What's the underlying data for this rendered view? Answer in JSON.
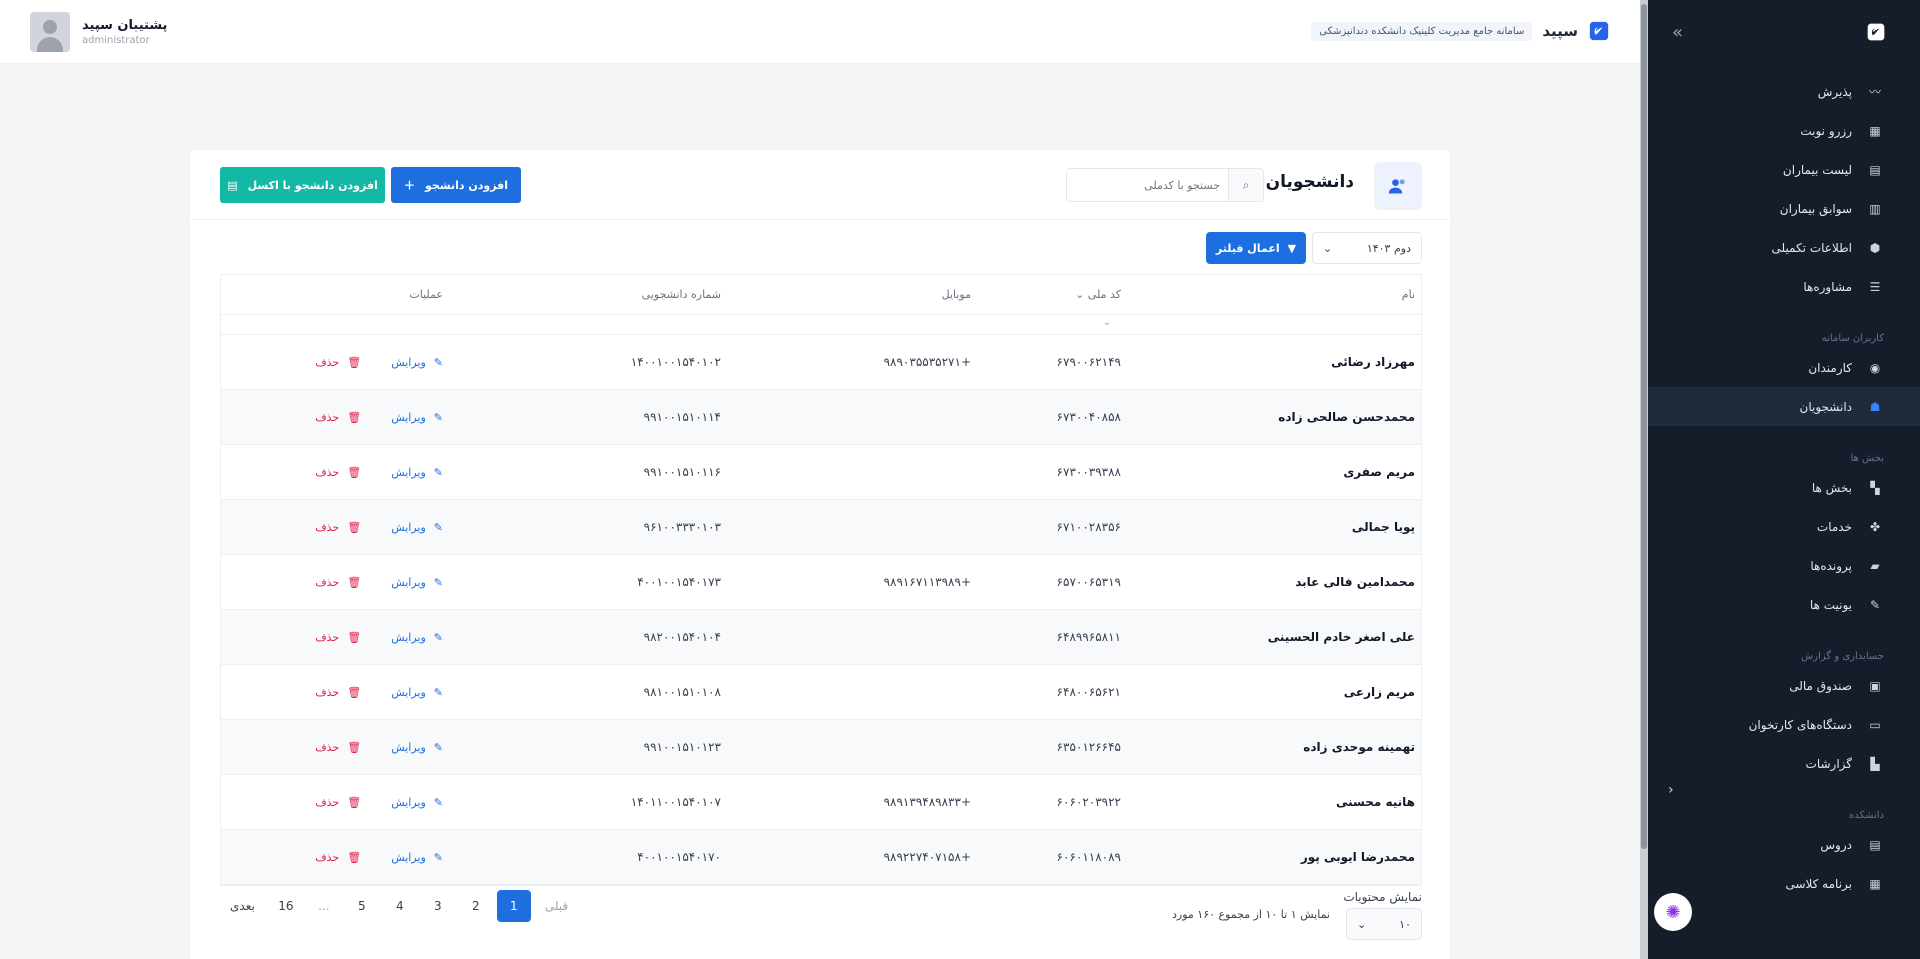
{
  "brand": {
    "name": "سپید",
    "subtitle": "سامانه جامع مدیریت کلینیک دانشکده دندانپزشکی"
  },
  "user": {
    "name": "پشتیبان سپید",
    "role": "administrator"
  },
  "sidebar": {
    "main_items": [
      {
        "label": "پذیرش",
        "icon": "heartbeat-icon"
      },
      {
        "label": "رزرو نوبت",
        "icon": "calendar-icon"
      },
      {
        "label": "لیست بیماران",
        "icon": "contacts-icon"
      },
      {
        "label": "سوابق بیماران",
        "icon": "document-icon"
      },
      {
        "label": "اطلاعات تکمیلی",
        "icon": "cube-icon"
      },
      {
        "label": "مشاوره‌ها",
        "icon": "bars-icon"
      }
    ],
    "section_users": "کاربران سامانه",
    "users_items": [
      {
        "label": "کارمندان",
        "icon": "user-circle-icon"
      },
      {
        "label": "دانشجویان",
        "icon": "students-icon"
      }
    ],
    "section_depts": "بخش ها",
    "dept_items": [
      {
        "label": "بخش ها",
        "icon": "grid-icon"
      },
      {
        "label": "خدمات",
        "icon": "fan-icon"
      },
      {
        "label": "پرونده‌ها",
        "icon": "folder-icon"
      },
      {
        "label": "یونیت ها",
        "icon": "syringe-icon"
      }
    ],
    "section_finance": "حسابداری و گزارش",
    "finance_items": [
      {
        "label": "صندوق مالی",
        "icon": "cash-box-icon"
      },
      {
        "label": "دستگاه‌های کارتخوان",
        "icon": "card-reader-icon"
      },
      {
        "label": "گزارشات",
        "icon": "chart-icon"
      }
    ],
    "section_faculty": "دانشکده",
    "faculty_items": [
      {
        "label": "دروس",
        "icon": "book-icon"
      },
      {
        "label": "برنامه کلاسی",
        "icon": "schedule-icon"
      }
    ]
  },
  "page": {
    "title": "دانشجویان",
    "search_placeholder": "جستجو با کدملی",
    "add_button": "افزودن دانشجو",
    "excel_button": "افزودن دانشجو با اکسل",
    "semester": "دوم ۱۴۰۳",
    "filter_button": "اعمال فیلتر"
  },
  "table": {
    "headers": {
      "name": "نام",
      "nid": "کد ملی",
      "mobile": "موبایل",
      "sno": "شماره دانشجویی",
      "ops": "عملیات"
    },
    "edit_label": "ویرایش",
    "delete_label": "حذف",
    "rows": [
      {
        "name": "مهرزاد رضائی",
        "nid": "۶۷۹۰۰۶۲۱۴۹",
        "mobile": "+۹۸۹۰۳۵۵۳۵۲۷۱",
        "sno": "۱۴۰۰۱۰۰۱۵۴۰۱۰۲"
      },
      {
        "name": "محمدحسن صالحی زاده",
        "nid": "۶۷۳۰۰۴۰۸۵۸",
        "mobile": "",
        "sno": "۹۹۱۰۰۱۵۱۰۱۱۴"
      },
      {
        "name": "مریم صفری",
        "nid": "۶۷۳۰۰۳۹۳۸۸",
        "mobile": "",
        "sno": "۹۹۱۰۰۱۵۱۰۱۱۶"
      },
      {
        "name": "پویا جمالی",
        "nid": "۶۷۱۰۰۲۸۳۵۶",
        "mobile": "",
        "sno": "۹۶۱۰۰۳۳۳۰۱۰۳"
      },
      {
        "name": "محمدامین فالی عابد",
        "nid": "۶۵۷۰۰۶۵۳۱۹",
        "mobile": "+۹۸۹۱۶۷۱۱۳۹۸۹",
        "sno": "۴۰۰۱۰۰۱۵۴۰۱۷۳"
      },
      {
        "name": "علی اصغر خادم الحسینی",
        "nid": "۶۴۸۹۹۶۵۸۱۱",
        "mobile": "",
        "sno": "۹۸۲۰۰۱۵۴۰۱۰۴"
      },
      {
        "name": "مریم زارعی",
        "nid": "۶۴۸۰۰۶۵۶۲۱",
        "mobile": "",
        "sno": "۹۸۱۰۰۱۵۱۰۱۰۸"
      },
      {
        "name": "تهمینه موحدی زاده",
        "nid": "۶۳۵۰۱۲۶۶۴۵",
        "mobile": "",
        "sno": "۹۹۱۰۰۱۵۱۰۱۲۳"
      },
      {
        "name": "هانیه محسنی",
        "nid": "۶۰۶۰۲۰۳۹۲۲",
        "mobile": "+۹۸۹۱۳۹۴۸۹۸۳۳",
        "sno": "۱۴۰۱۱۰۰۱۵۴۰۱۰۷"
      },
      {
        "name": "محمدرضا ایوبی پور",
        "nid": "۶۰۶۰۱۱۸۰۸۹",
        "mobile": "+۹۸۹۲۲۷۴۰۷۱۵۸",
        "sno": "۴۰۰۱۰۰۱۵۴۰۱۷۰"
      }
    ]
  },
  "footer": {
    "per_page_label": "نمایش محتویات",
    "per_page_value": "۱۰",
    "summary": "نمایش ۱ تا ۱۰ از مجموع ۱۶۰ مورد",
    "prev": "قبلی",
    "next": "بعدی",
    "pages": [
      "1",
      "2",
      "3",
      "4",
      "5",
      "...",
      "16"
    ]
  }
}
